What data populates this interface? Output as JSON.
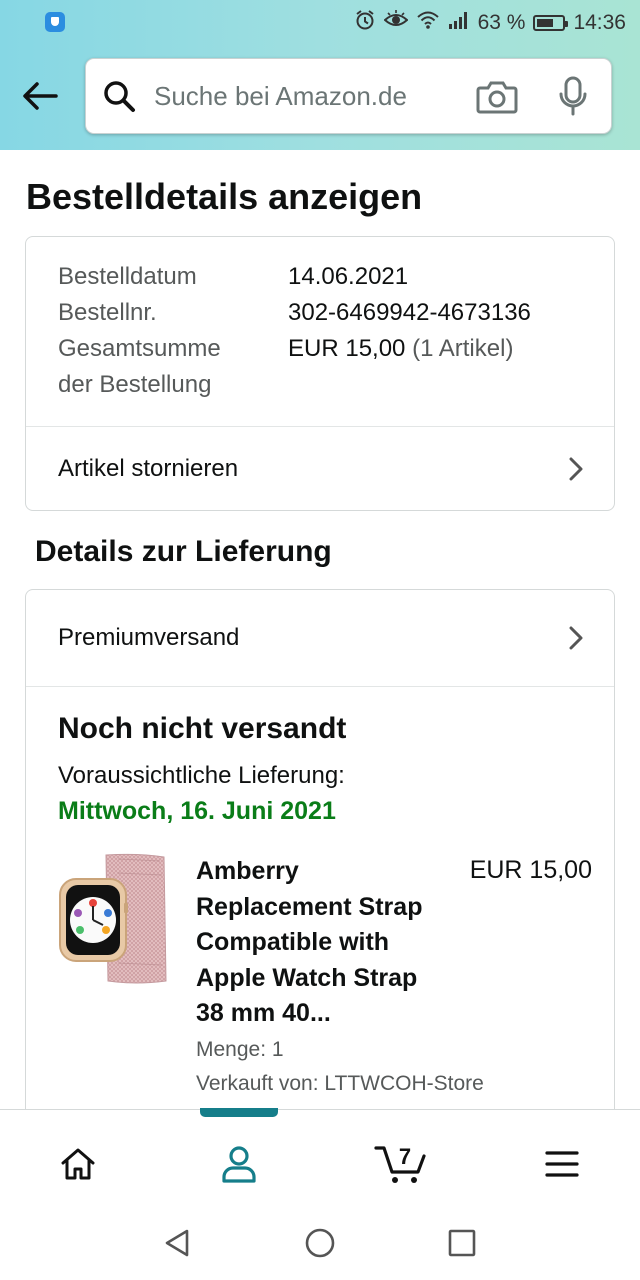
{
  "status_bar": {
    "battery_percent": "63 %",
    "battery_level": 0.63,
    "time": "14:36"
  },
  "header": {
    "search_placeholder": "Suche bei Amazon.de"
  },
  "page": {
    "title": "Bestelldetails anzeigen"
  },
  "order_info": {
    "rows": [
      {
        "label": "Bestelldatum",
        "value": "14.06.2021"
      },
      {
        "label": "Bestellnr.",
        "value": "302-6469942-4673136"
      },
      {
        "label_line1": "Gesamtsumme",
        "label_line2": "der Bestellung",
        "value": "EUR 15,00",
        "value_extra": "(1 Artikel)"
      }
    ],
    "cancel_link": "Artikel stornieren"
  },
  "delivery": {
    "section_title": "Details zur Lieferung",
    "shipping_method": "Premiumversand",
    "status": "Noch nicht versandt",
    "expected_label": "Voraussichtliche Lieferung:",
    "expected_date": "Mittwoch, 16. Juni 2021"
  },
  "product": {
    "title_lines": [
      "Amberry",
      "Replacement Strap",
      "Compatible with",
      "Apple Watch Strap",
      "38 mm 40..."
    ],
    "price": "EUR 15,00",
    "quantity": "Menge: 1",
    "seller": "Verkauft von: LTTWCOH-Store"
  },
  "bottom_nav": {
    "active": "account",
    "cart_count": "7"
  },
  "colors": {
    "header_gradient_start": "#86d7e4",
    "header_gradient_end": "#a9e4d4",
    "active_nav": "#157e8a",
    "delivery_green": "#0a7d18"
  }
}
